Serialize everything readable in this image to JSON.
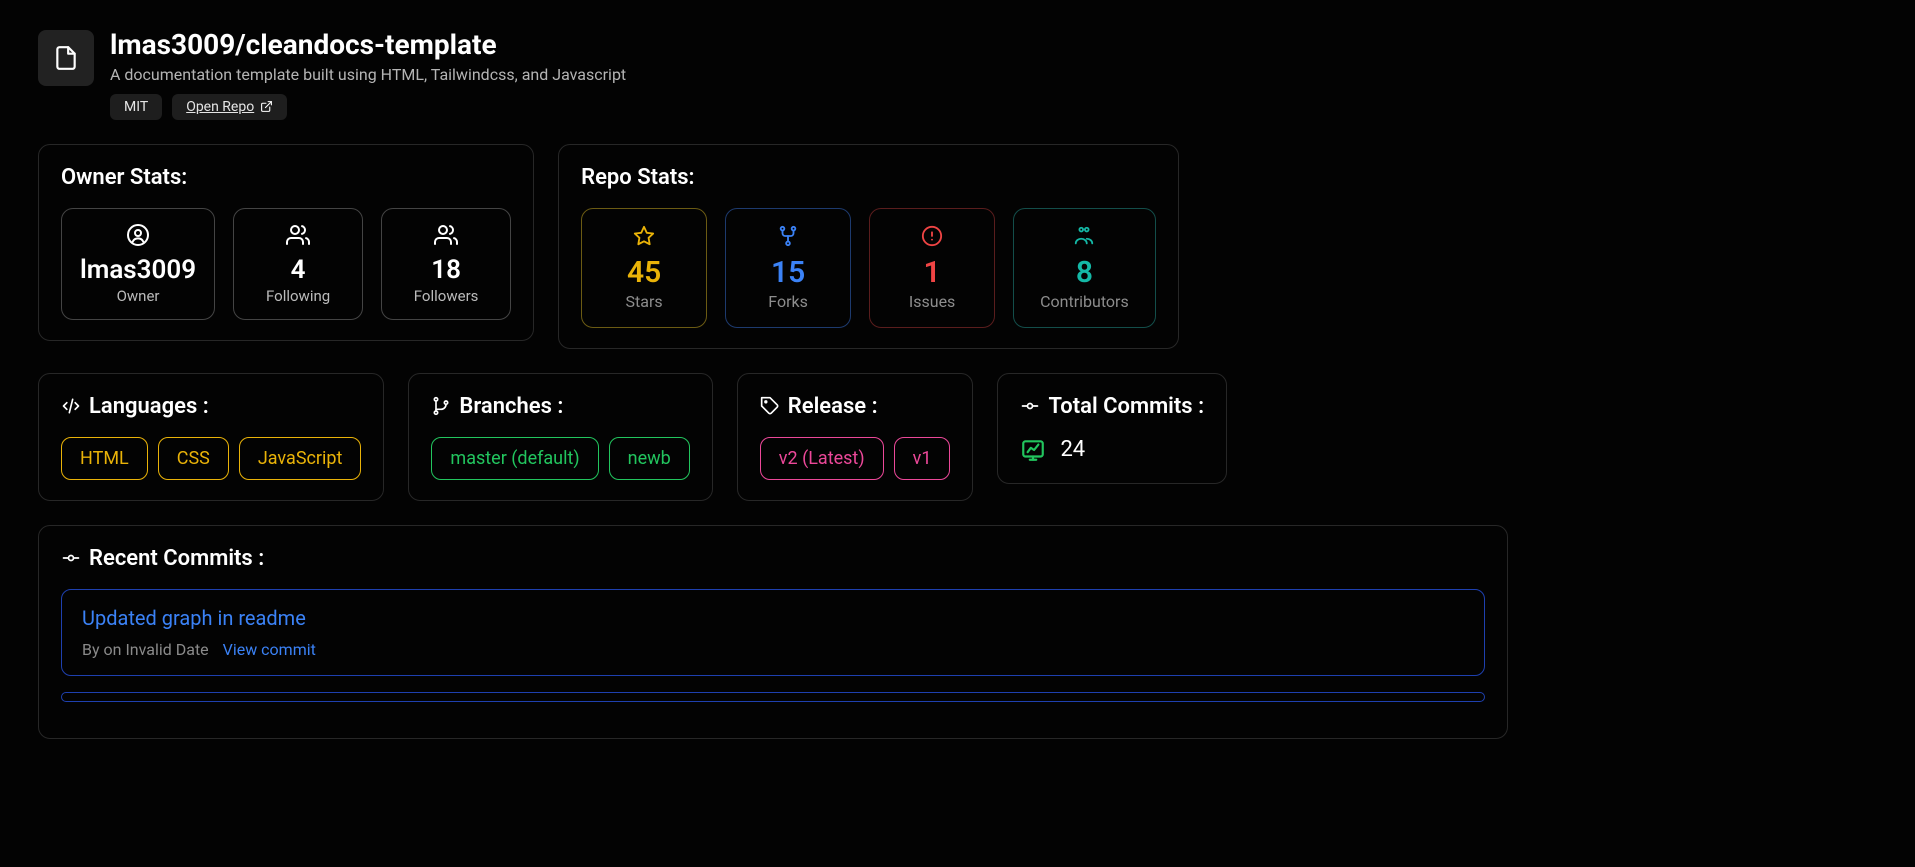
{
  "header": {
    "title": "lmas3009/cleandocs-template",
    "description": "A documentation template built using HTML, Tailwindcss, and Javascript",
    "license": "MIT",
    "open_repo": "Open Repo"
  },
  "owner_stats": {
    "title": "Owner Stats:",
    "owner_name": "lmas3009",
    "owner_label": "Owner",
    "following_value": "4",
    "following_label": "Following",
    "followers_value": "18",
    "followers_label": "Followers"
  },
  "repo_stats": {
    "title": "Repo Stats:",
    "stars_value": "45",
    "stars_label": "Stars",
    "forks_value": "15",
    "forks_label": "Forks",
    "issues_value": "1",
    "issues_label": "Issues",
    "contributors_value": "8",
    "contributors_label": "Contributors"
  },
  "languages": {
    "title": "Languages :",
    "items": [
      "HTML",
      "CSS",
      "JavaScript"
    ]
  },
  "branches": {
    "title": "Branches :",
    "items": [
      "master (default)",
      "newb"
    ]
  },
  "releases": {
    "title": "Release :",
    "items": [
      "v2 (Latest)",
      "v1"
    ]
  },
  "total_commits": {
    "title": "Total Commits :",
    "value": "24"
  },
  "recent_commits": {
    "title": "Recent Commits :",
    "items": [
      {
        "message": "Updated graph in readme",
        "byline": "By on Invalid Date",
        "link_text": "View commit"
      }
    ]
  }
}
